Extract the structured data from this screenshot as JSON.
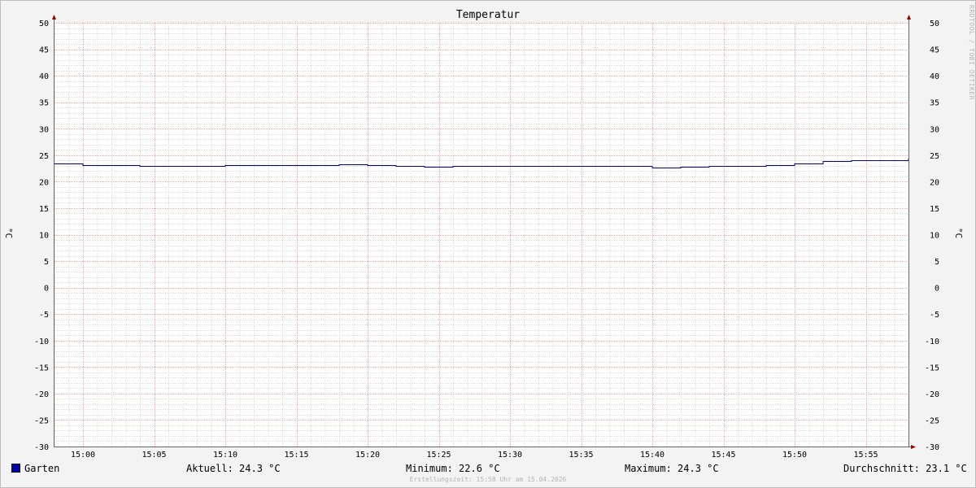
{
  "watermark": "RRDTOOL / TOBI OETIKER",
  "chart_data": {
    "type": "line",
    "title": "Temperatur",
    "ylabel": "°C",
    "ylim": [
      -30,
      50
    ],
    "y_ticks": [
      50,
      45,
      40,
      35,
      30,
      25,
      20,
      15,
      10,
      5,
      0,
      -5,
      -10,
      -15,
      -20,
      -25,
      -30
    ],
    "x_range": [
      "14:58",
      "15:58"
    ],
    "x_ticks": [
      "15:00",
      "15:05",
      "15:10",
      "15:15",
      "15:20",
      "15:25",
      "15:30",
      "15:35",
      "15:40",
      "15:45",
      "15:50",
      "15:55"
    ],
    "grid": true,
    "series": [
      {
        "name": "Garten",
        "color": "#0000aa",
        "step": true,
        "x": [
          "14:58",
          "15:00",
          "15:04",
          "15:10",
          "15:16",
          "15:18",
          "15:20",
          "15:22",
          "15:24",
          "15:26",
          "15:40",
          "15:42",
          "15:44",
          "15:48",
          "15:50",
          "15:52",
          "15:54",
          "15:58"
        ],
        "values": [
          23.4,
          23.1,
          22.9,
          23.1,
          23.1,
          23.3,
          23.1,
          22.9,
          22.8,
          23.0,
          22.6,
          22.8,
          22.9,
          23.1,
          23.4,
          23.9,
          24.1,
          24.3
        ]
      }
    ]
  },
  "legend": {
    "series_name": "Garten",
    "current": "Aktuell: 24.3 °C",
    "minimum": "Minimum: 22.6 °C",
    "maximum": "Maximum: 24.3 °C",
    "average": "Durchschnitt: 23.1 °C"
  },
  "footer": "Erstellungszeit: 15:58 Uhr am 15.04.2026"
}
